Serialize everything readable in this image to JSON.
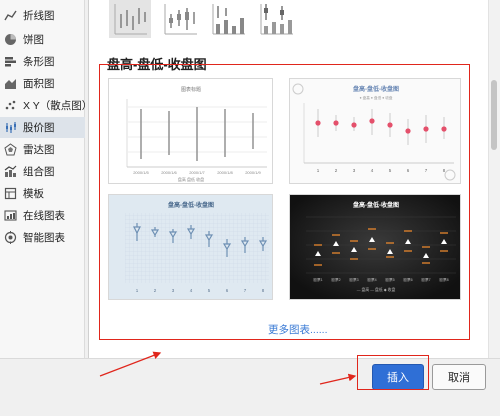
{
  "sidebar": {
    "items": [
      {
        "label": "折线图",
        "icon": "line-chart-icon"
      },
      {
        "label": "饼图",
        "icon": "pie-chart-icon"
      },
      {
        "label": "条形图",
        "icon": "bar-chart-icon"
      },
      {
        "label": "面积图",
        "icon": "area-chart-icon"
      },
      {
        "label": "X Y（散点图）",
        "icon": "scatter-chart-icon"
      },
      {
        "label": "股价图",
        "icon": "stock-chart-icon",
        "selected": true
      },
      {
        "label": "雷达图",
        "icon": "radar-chart-icon"
      },
      {
        "label": "组合图",
        "icon": "combo-chart-icon"
      },
      {
        "label": "模板",
        "icon": "template-icon"
      },
      {
        "label": "在线图表",
        "icon": "online-chart-icon"
      },
      {
        "label": "智能图表",
        "icon": "smart-chart-icon"
      }
    ]
  },
  "main": {
    "section_title": "盘高-盘低-收盘图",
    "more_link": "更多图表......",
    "cards": [
      {
        "title": "图表标题",
        "legend": "盘高 盘低 收盘",
        "x_labels": [
          "2000/1/5",
          "2000/1/6",
          "2000/1/7",
          "2000/1/8",
          "2000/1/9"
        ],
        "style": "plain"
      },
      {
        "title": "盘高-盘低-收盘图",
        "legend": "● 盘高  ● 盘低  ● 收盘",
        "x_labels": [
          "1",
          "2",
          "3",
          "4",
          "5",
          "6",
          "7",
          "8"
        ],
        "style": "pink"
      },
      {
        "title": "盘高-盘低-收盘图",
        "x_labels": [
          "1",
          "2",
          "3",
          "4",
          "5",
          "6",
          "7",
          "8"
        ],
        "style": "blue"
      },
      {
        "title": "盘高-盘低-收盘图",
        "legend": "— 盘高  — 盘低  ◆ 收盘",
        "x_labels": [
          "股票1",
          "股票2",
          "股票3",
          "股票4",
          "股票5",
          "股票6",
          "股票7",
          "股票8"
        ],
        "style": "dark"
      }
    ]
  },
  "footer": {
    "insert_label": "插入",
    "cancel_label": "取消"
  },
  "colors": {
    "accent": "#2f6fd6",
    "highlight_red": "#e0261c",
    "selected_bg": "#dde3ea"
  }
}
